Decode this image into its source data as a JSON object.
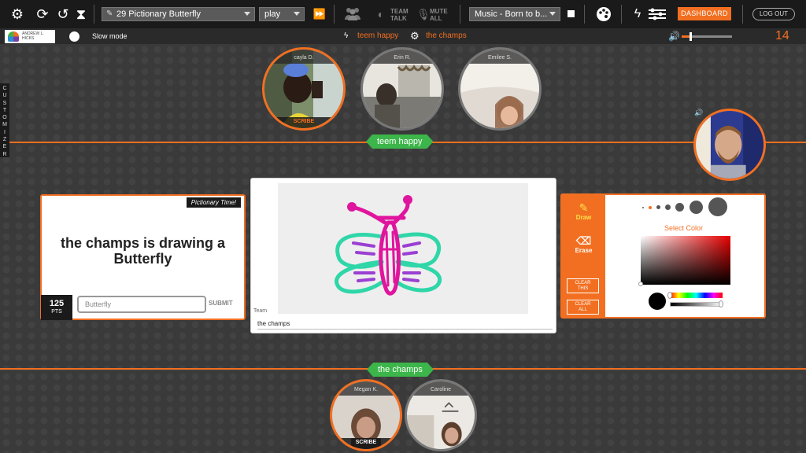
{
  "toolbar": {
    "game_select": "29 Pictionary Butterfly",
    "mode_select": "play",
    "team_talk": "TEAM\nTALK",
    "mute_all": "MUTE\nALL",
    "music_select": "Music - Born to b...",
    "dashboard_label": "DASHBOARD",
    "logout_label": "LOG OUT"
  },
  "subbar": {
    "logo_text": "ANDREW L. HICKS",
    "slow_mode_label": "Slow mode",
    "team_a": "teem happy",
    "team_b": "the champs",
    "volume_fraction": 0.17,
    "counter": "14"
  },
  "customizer_label": "CUSTOMIZER",
  "top_team": {
    "pill": "teem happy",
    "players": [
      {
        "name": "cayla D.",
        "scribe": "SCRIBE"
      },
      {
        "name": "Erin R."
      },
      {
        "name": "Emilee S."
      }
    ]
  },
  "bottom_team": {
    "pill": "the champs",
    "players": [
      {
        "name": "Megan K.",
        "scribe": "SCRIBE"
      },
      {
        "name": "Caroline"
      }
    ]
  },
  "word_panel": {
    "badge": "Pictionary Time!",
    "title": "the champs is drawing a Butterfly",
    "points": "125",
    "points_unit": "PTS",
    "guess_value": "Butterfly",
    "submit_label": "SUBMIT"
  },
  "canvas": {
    "team_label": "Team",
    "team_value": "the champs"
  },
  "tools": {
    "draw_label": "Draw",
    "erase_label": "Erase",
    "clear_this": "CLEAR\nTHIS",
    "clear_all": "CLEAR\nALL",
    "select_color_label": "Select Color",
    "accent": "#f26f21",
    "current_color": "#000000"
  }
}
